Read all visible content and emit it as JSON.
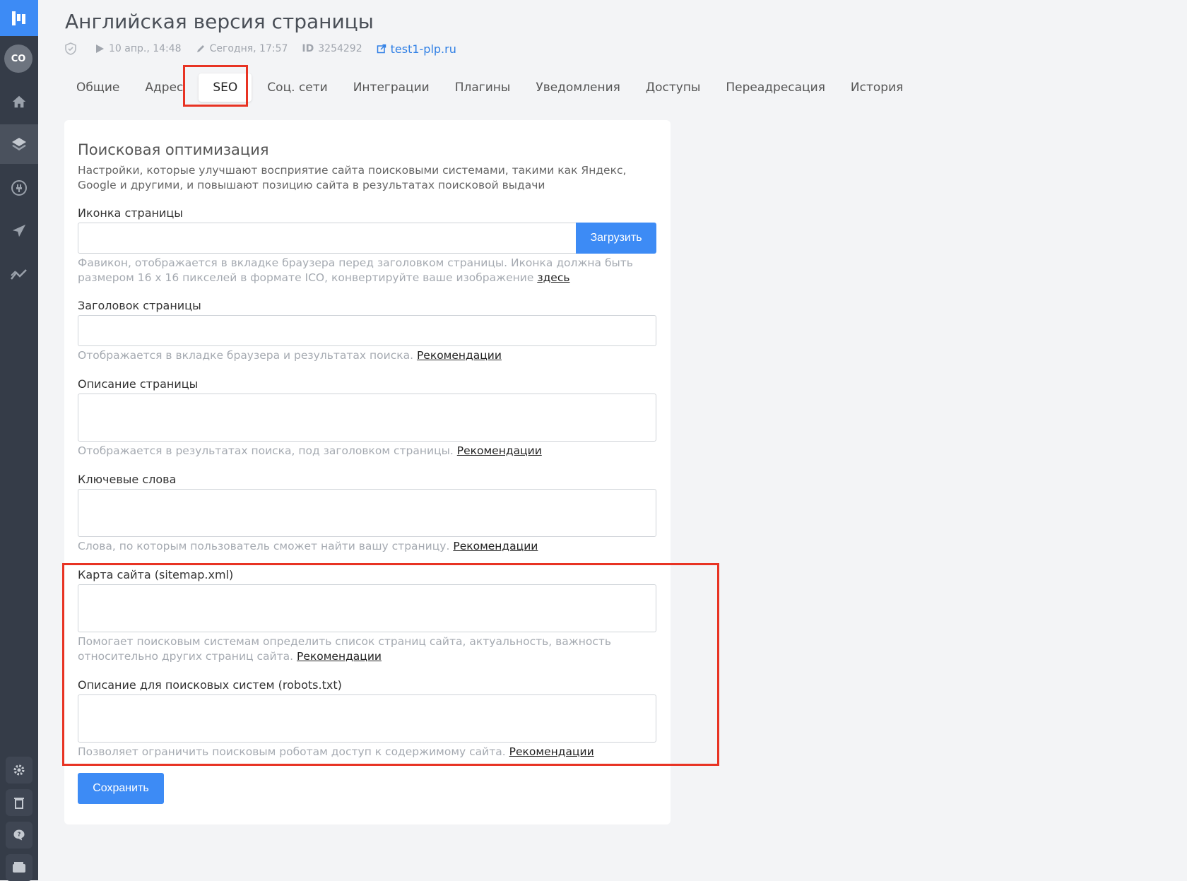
{
  "sidebar": {
    "avatar": "CO",
    "icons": [
      "logo-icon",
      "home-icon",
      "layers-icon",
      "plugin-icon",
      "send-icon",
      "analytics-icon",
      "settings-icon",
      "trash-icon",
      "help-icon",
      "wallet-icon"
    ]
  },
  "header": {
    "title": "Английская версия страницы",
    "published": "10 апр., 14:48",
    "edited": "Сегодня, 17:57",
    "id_label": "ID",
    "id_value": "3254292",
    "domain": "test1-plp.ru"
  },
  "tabs": [
    "Общие",
    "Адрес",
    "SEO",
    "Соц. сети",
    "Интеграции",
    "Плагины",
    "Уведомления",
    "Доступы",
    "Переадресация",
    "История"
  ],
  "seo": {
    "title": "Поисковая оптимизация",
    "subtitle": "Настройки, которые улучшают восприятие сайта поисковыми системами, такими как Яндекс, Google и другими, и повышают позицию сайта в результатах поисковой выдачи",
    "icon_label": "Иконка страницы",
    "icon_value": "",
    "upload_label": "Загрузить",
    "icon_help": "Фавикон, отображается в вкладке браузера перед заголовком страницы. Иконка должна быть размером 16 х 16 пикселей в формате ICO, конвертируйте ваше изображение",
    "icon_help_link": "здесь",
    "title_label": "Заголовок страницы",
    "title_help": "Отображается в вкладке браузера и результатах поиска.",
    "description_label": "Описание страницы",
    "description_help": "Отображается в результатах поиска, под заголовком страницы.",
    "keywords_label": "Ключевые слова",
    "keywords_help": "Слова, по которым пользователь сможет найти вашу страницу.",
    "sitemap_label": "Карта сайта (sitemap.xml)",
    "sitemap_help": "Помогает поисковым системам определить список страниц сайта, актуальность, важность относительно других страниц сайта.",
    "robots_label": "Описание для поисковых систем (robots.txt)",
    "robots_help": "Позволяет ограничить поисковым роботам доступ к содержимому сайта.",
    "recommendations": "Рекомендации",
    "save_label": "Сохранить"
  },
  "colors": {
    "accent": "#3d8bf5",
    "sidebar": "#353c48",
    "highlight": "#e83323"
  }
}
